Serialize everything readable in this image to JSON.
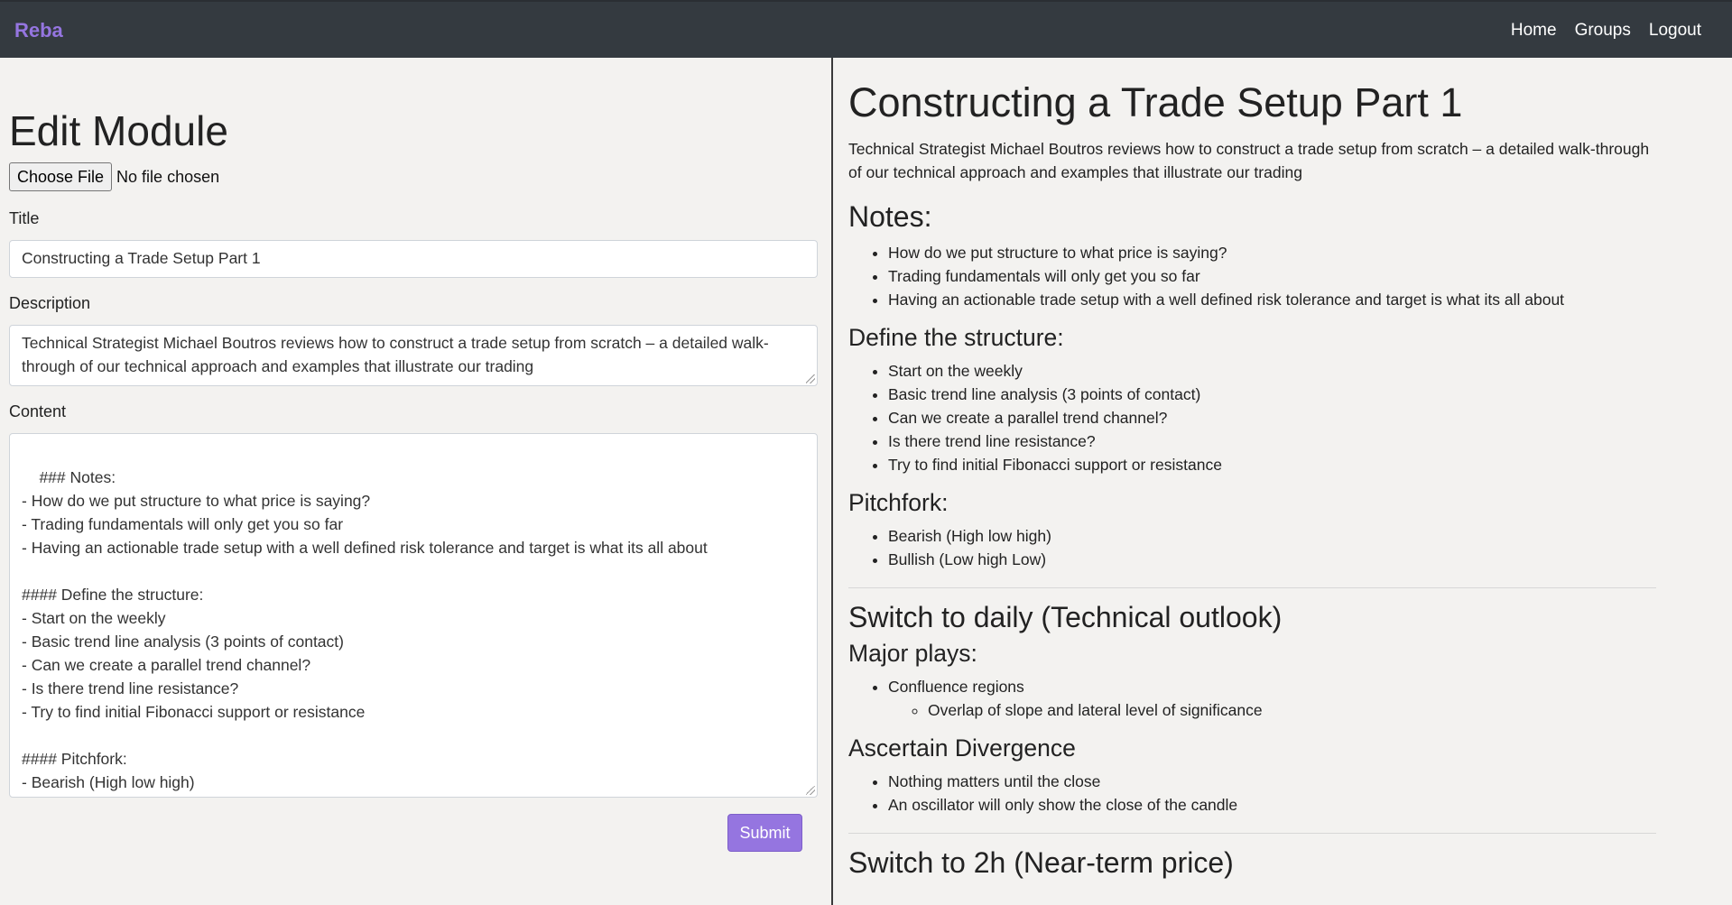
{
  "nav": {
    "brand": "Reba",
    "links": [
      "Home",
      "Groups",
      "Logout"
    ]
  },
  "form": {
    "heading": "Edit Module",
    "file_button": "Choose File",
    "file_status": "No file chosen",
    "title_label": "Title",
    "title_value": "Constructing a Trade Setup Part 1",
    "description_label": "Description",
    "description_value": "Technical Strategist Michael Boutros reviews how to construct a trade setup from scratch – a detailed walk-through of our technical approach and examples that illustrate our trading",
    "content_label": "Content",
    "content_value": "### Notes:\n- How do we put structure to what price is saying?\n- Trading fundamentals will only get you so far\n- Having an actionable trade setup with a well defined risk tolerance and target is what its all about\n\n#### Define the structure:\n- Start on the weekly\n- Basic trend line analysis (3 points of contact)\n- Can we create a parallel trend channel?\n- Is there trend line resistance?\n- Try to find initial Fibonacci support or resistance\n\n#### Pitchfork:\n- Bearish (High low high)\n- Bullish (Low high Low)",
    "submit_label": "Submit"
  },
  "preview": {
    "title": "Constructing a Trade Setup Part 1",
    "description": "Technical Strategist Michael Boutros reviews how to construct a trade setup from scratch – a detailed walk-through of our technical approach and examples that illustrate our trading",
    "notes_heading": "Notes:",
    "notes": [
      "How do we put structure to what price is saying?",
      "Trading fundamentals will only get you so far",
      "Having an actionable trade setup with a well defined risk tolerance and target is what its all about"
    ],
    "structure_heading": "Define the structure:",
    "structure": [
      "Start on the weekly",
      "Basic trend line analysis (3 points of contact)",
      "Can we create a parallel trend channel?",
      "Is there trend line resistance?",
      "Try to find initial Fibonacci support or resistance"
    ],
    "pitchfork_heading": "Pitchfork:",
    "pitchfork": [
      "Bearish (High low high)",
      "Bullish (Low high Low)"
    ],
    "daily_heading": "Switch to daily (Technical outlook)",
    "major_plays_heading": "Major plays:",
    "major_plays_item": "Confluence regions",
    "major_plays_sub": "Overlap of slope and lateral level of significance",
    "divergence_heading": "Ascertain Divergence",
    "divergence": [
      "Nothing matters until the close",
      "An oscillator will only show the close of the candle"
    ],
    "twohour_heading": "Switch to 2h (Near-term price)"
  }
}
